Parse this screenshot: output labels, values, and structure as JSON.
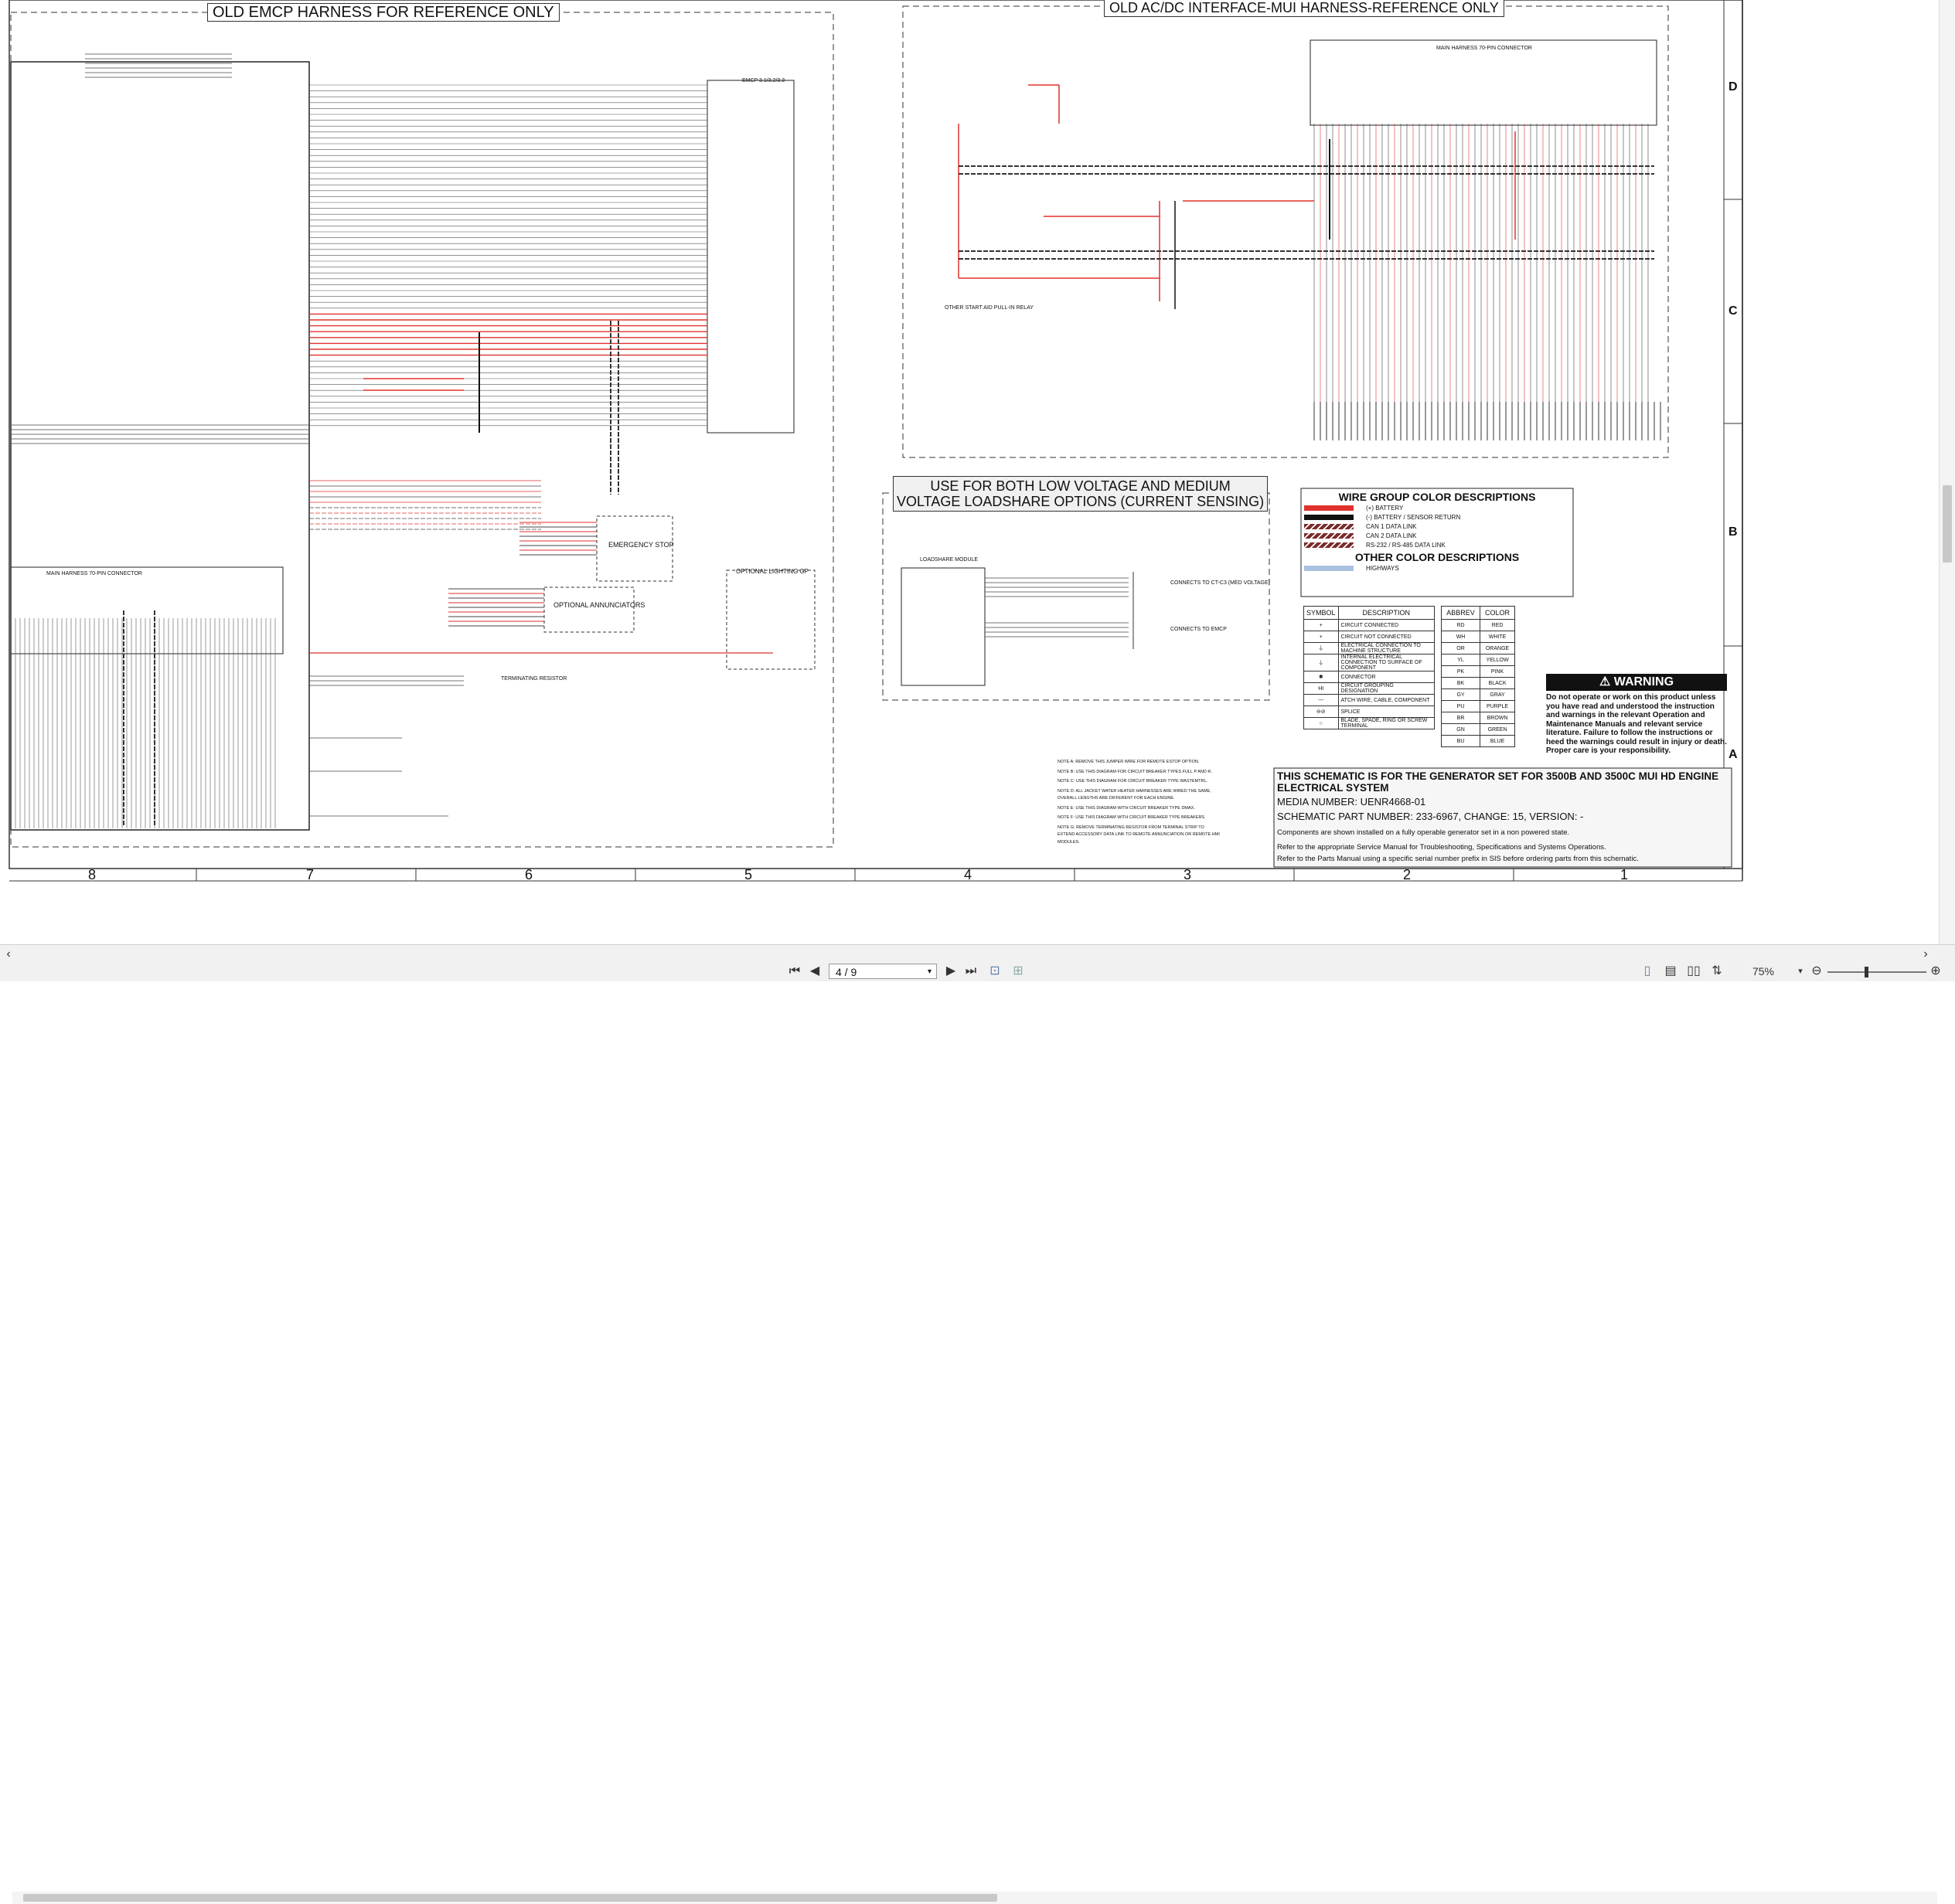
{
  "panels": {
    "emcp_title": "OLD EMCP HARNESS FOR REFERENCE ONLY",
    "acdc_title": "OLD AC/DC INTERFACE-MUI HARNESS-REFERENCE ONLY",
    "loadshare_title_line1": "USE FOR BOTH LOW VOLTAGE AND MEDIUM",
    "loadshare_title_line2": "VOLTAGE LOADSHARE OPTIONS (CURRENT SENSING)"
  },
  "labels": {
    "main_harness_connector": "MAIN HARNESS 70-PIN CONNECTOR",
    "main_harness_connector_2": "MAIN HARNESS 70-PIN CONNECTOR",
    "emcp_controller": "EMCP 3.1/3.2/3.3",
    "emergency_stop": "EMERGENCY STOP",
    "optional_annunciators": "OPTIONAL ANNUNCIATORS",
    "optional_lighting": "OPTIONAL LIGHTING GP",
    "terminating_resistor": "TERMINATING RESISTOR",
    "loadshare_module": "LOADSHARE MODULE",
    "connects_to_ct": "CONNECTS TO CT-C3 (MED VOLTAGE)",
    "connects_to_emcp": "CONNECTS TO EMCP",
    "other_start_aid": "OTHER START AID PULL-IN RELAY"
  },
  "legend": {
    "title": "WIRE GROUP COLOR DESCRIPTIONS",
    "items": [
      {
        "label": "(+) BATTERY",
        "color": "#e0322d",
        "style": "solid"
      },
      {
        "label": "(-) BATTERY / SENSOR RETURN",
        "color": "#111111",
        "style": "solid"
      },
      {
        "label": "CAN 1 DATA LINK",
        "color": "#7a2b2b",
        "style": "hatch"
      },
      {
        "label": "CAN 2 DATA LINK",
        "color": "#7a2b2b",
        "style": "hatch"
      },
      {
        "label": "RS-232 / RS-485 DATA LINK",
        "color": "#7a2b2b",
        "style": "hatch"
      }
    ],
    "other_title": "OTHER COLOR DESCRIPTIONS",
    "other_items": [
      {
        "label": "HIGHWAYS",
        "color": "#a9c0e0",
        "style": "solid"
      }
    ]
  },
  "symbols": {
    "headers": [
      "SYMBOL",
      "DESCRIPTION"
    ],
    "rows": [
      {
        "symbol": "+",
        "description": "CIRCUIT CONNECTED"
      },
      {
        "symbol": "+",
        "description": "CIRCUIT NOT CONNECTED"
      },
      {
        "symbol": "⏚",
        "description": "ELECTRICAL CONNECTION TO MACHINE STRUCTURE"
      },
      {
        "symbol": "⏚",
        "description": "INTERNAL ELECTRICAL CONNECTION TO SURFACE OF COMPONENT"
      },
      {
        "symbol": "✱",
        "description": "CONNECTOR"
      },
      {
        "symbol": "HI",
        "description": "CIRCUIT GROUPING DESIGNATION"
      },
      {
        "symbol": "---",
        "description": "ATCH WIRE, CABLE, COMPONENT"
      },
      {
        "symbol": "⊖⊘",
        "description": "SPLICE"
      },
      {
        "symbol": "○",
        "description": "BLADE, SPADE, RING OR SCREW TERMINAL"
      }
    ]
  },
  "colors_table": {
    "headers": [
      "ABBREV",
      "COLOR"
    ],
    "rows": [
      [
        "RD",
        "RED"
      ],
      [
        "WH",
        "WHITE"
      ],
      [
        "OR",
        "ORANGE"
      ],
      [
        "YL",
        "YELLOW"
      ],
      [
        "PK",
        "PINK"
      ],
      [
        "BK",
        "BLACK"
      ],
      [
        "GY",
        "GRAY"
      ],
      [
        "PU",
        "PURPLE"
      ],
      [
        "BR",
        "BROWN"
      ],
      [
        "GN",
        "GREEN"
      ],
      [
        "BU",
        "BLUE"
      ]
    ]
  },
  "warning": {
    "header": "⚠ WARNING",
    "text": "Do not operate or work on this product unless you have read and understood the instruction and warnings in the relevant Operation and Maintenance Manuals and relevant service literature. Failure to follow the instructions or heed the warnings could result in injury or death. Proper care is your responsibility."
  },
  "notes": [
    "NOTE A: REMOVE THIS JUMPER WIRE FOR REMOTE ESTOP OPTION.",
    "NOTE B: USE THIS DIAGRAM FOR CIRCUIT BREAKER TYPES FULL P AND R.",
    "NOTE C: USE THIS DIAGRAM FOR CIRCUIT BREAKER TYPE WASTEMTRL.",
    "NOTE D: ALL JACKET WATER HEATER HARNESSES ARE WIRED THE SAME, OVERALL LENGTHS ARE DIFFERENT FOR EACH ENGINE.",
    "NOTE E: USE THIS DIAGRAM WITH CIRCUIT BREAKER TYPE DMAX.",
    "NOTE F: USE THIS DIAGRAM WITH CIRCUIT BREAKER TYPE BREAKERS.",
    "NOTE G: REMOVE TERMINATING RESISTOR FROM TERMINAL STRIP TO EXTEND ACCESSORY DATA LINK TO REMOTE ANNUNCIATION OR REMOTE HMI MODULES."
  ],
  "title_block": {
    "heading_line1": "THIS SCHEMATIC IS FOR THE GENERATOR SET FOR 3500B AND 3500C MUI HD ENGINE",
    "heading_line2": "ELECTRICAL SYSTEM",
    "media": "MEDIA NUMBER: UENR4668-01",
    "part": "SCHEMATIC PART NUMBER: 233-6967, CHANGE: 15, VERSION: -",
    "line1": "Components are shown installed on a fully operable generator set in a non powered state.",
    "line2": "Refer to the appropriate Service Manual for Troubleshooting, Specifications and Systems Operations.",
    "line3": "Refer to the Parts Manual using a specific serial number prefix in SIS before ordering parts from this schematic."
  },
  "grid": {
    "columns": [
      "8",
      "7",
      "6",
      "5",
      "4",
      "3",
      "2",
      "1"
    ],
    "rows": [
      "D",
      "C",
      "B",
      "A"
    ]
  },
  "viewer": {
    "page_value": "4 / 9",
    "zoom": "75%",
    "colors": {
      "toolbar_bg": "#f1f1f1",
      "red_wire": "#e0322d",
      "black_wire": "#111111"
    }
  }
}
